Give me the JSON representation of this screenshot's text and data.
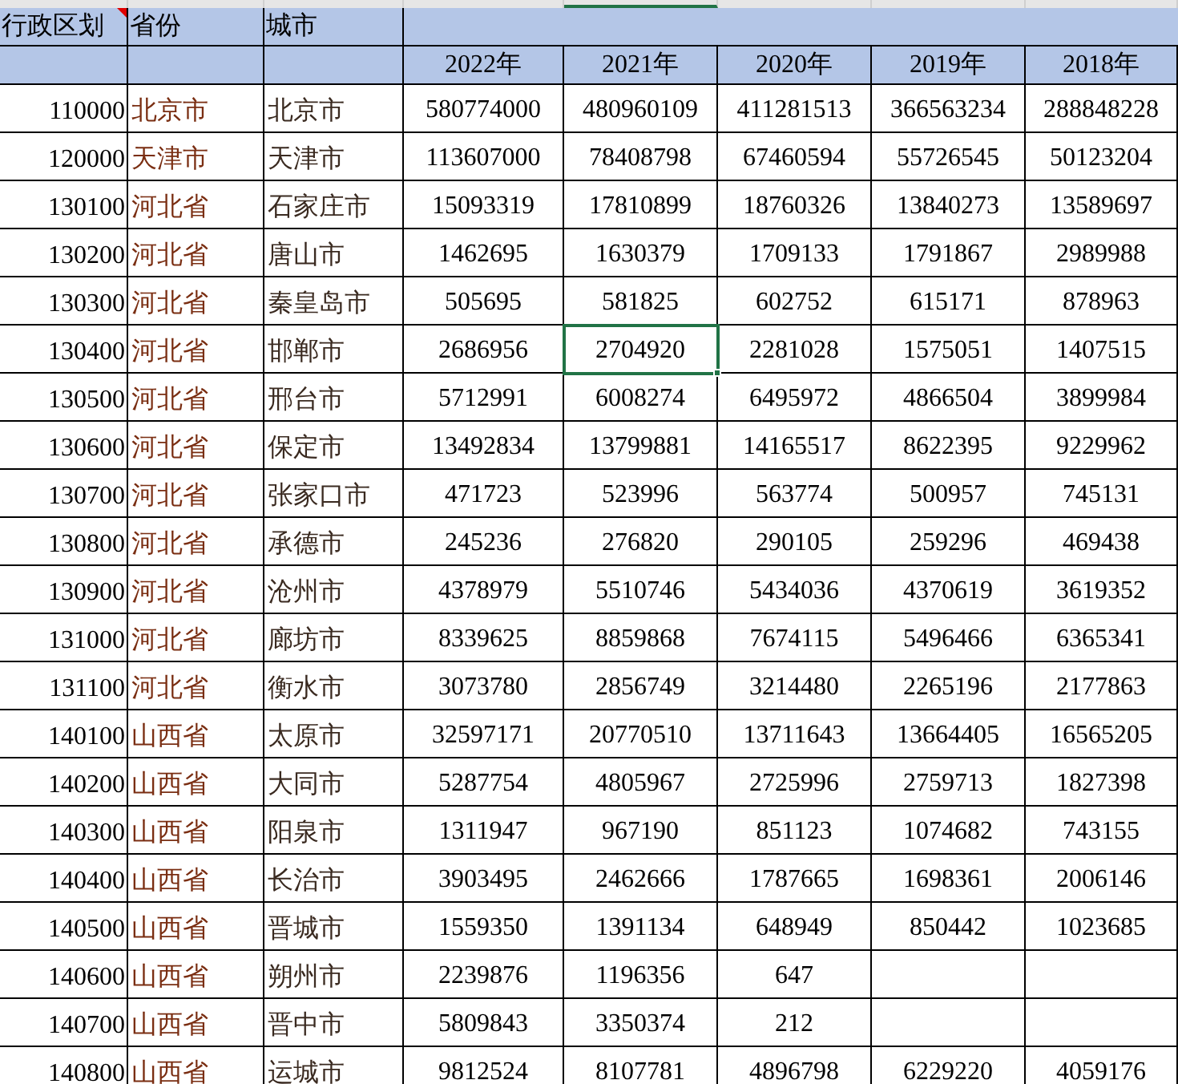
{
  "header": {
    "columns": [
      {
        "label": "行政区划",
        "comment": true
      },
      {
        "label": "省份",
        "comment": false
      },
      {
        "label": "城市",
        "comment": false
      }
    ],
    "years": [
      "2022年",
      "2021年",
      "2020年",
      "2019年",
      "2018年"
    ]
  },
  "rows": [
    {
      "code": "110000",
      "province": "北京市",
      "city": "北京市",
      "values": [
        {
          "text": "580774000",
          "selected": false
        },
        {
          "text": "480960109",
          "selected": false
        },
        {
          "text": "411281513",
          "selected": false
        },
        {
          "text": "366563234",
          "selected": false
        },
        {
          "text": "288848228",
          "selected": false
        }
      ]
    },
    {
      "code": "120000",
      "province": "天津市",
      "city": "天津市",
      "values": [
        {
          "text": "113607000",
          "selected": false
        },
        {
          "text": "78408798",
          "selected": false
        },
        {
          "text": "67460594",
          "selected": false
        },
        {
          "text": "55726545",
          "selected": false
        },
        {
          "text": "50123204",
          "selected": false
        }
      ]
    },
    {
      "code": "130100",
      "province": "河北省",
      "city": "石家庄市",
      "values": [
        {
          "text": "15093319",
          "selected": false
        },
        {
          "text": "17810899",
          "selected": false
        },
        {
          "text": "18760326",
          "selected": false
        },
        {
          "text": "13840273",
          "selected": false
        },
        {
          "text": "13589697",
          "selected": false
        }
      ]
    },
    {
      "code": "130200",
      "province": "河北省",
      "city": "唐山市",
      "values": [
        {
          "text": "1462695",
          "selected": false
        },
        {
          "text": "1630379",
          "selected": false
        },
        {
          "text": "1709133",
          "selected": false
        },
        {
          "text": "1791867",
          "selected": false
        },
        {
          "text": "2989988",
          "selected": false
        }
      ]
    },
    {
      "code": "130300",
      "province": "河北省",
      "city": "秦皇岛市",
      "values": [
        {
          "text": "505695",
          "selected": false
        },
        {
          "text": "581825",
          "selected": false
        },
        {
          "text": "602752",
          "selected": false
        },
        {
          "text": "615171",
          "selected": false
        },
        {
          "text": "878963",
          "selected": false
        }
      ]
    },
    {
      "code": "130400",
      "province": "河北省",
      "city": "邯郸市",
      "values": [
        {
          "text": "2686956",
          "selected": false
        },
        {
          "text": "2704920",
          "selected": true
        },
        {
          "text": "2281028",
          "selected": false
        },
        {
          "text": "1575051",
          "selected": false
        },
        {
          "text": "1407515",
          "selected": false
        }
      ]
    },
    {
      "code": "130500",
      "province": "河北省",
      "city": "邢台市",
      "values": [
        {
          "text": "5712991",
          "selected": false
        },
        {
          "text": "6008274",
          "selected": false
        },
        {
          "text": "6495972",
          "selected": false
        },
        {
          "text": "4866504",
          "selected": false
        },
        {
          "text": "3899984",
          "selected": false
        }
      ]
    },
    {
      "code": "130600",
      "province": "河北省",
      "city": "保定市",
      "values": [
        {
          "text": "13492834",
          "selected": false
        },
        {
          "text": "13799881",
          "selected": false
        },
        {
          "text": "14165517",
          "selected": false
        },
        {
          "text": "8622395",
          "selected": false
        },
        {
          "text": "9229962",
          "selected": false
        }
      ]
    },
    {
      "code": "130700",
      "province": "河北省",
      "city": "张家口市",
      "values": [
        {
          "text": "471723",
          "selected": false
        },
        {
          "text": "523996",
          "selected": false
        },
        {
          "text": "563774",
          "selected": false
        },
        {
          "text": "500957",
          "selected": false
        },
        {
          "text": "745131",
          "selected": false
        }
      ]
    },
    {
      "code": "130800",
      "province": "河北省",
      "city": "承德市",
      "values": [
        {
          "text": "245236",
          "selected": false
        },
        {
          "text": "276820",
          "selected": false
        },
        {
          "text": "290105",
          "selected": false
        },
        {
          "text": "259296",
          "selected": false
        },
        {
          "text": "469438",
          "selected": false
        }
      ]
    },
    {
      "code": "130900",
      "province": "河北省",
      "city": "沧州市",
      "values": [
        {
          "text": "4378979",
          "selected": false
        },
        {
          "text": "5510746",
          "selected": false
        },
        {
          "text": "5434036",
          "selected": false
        },
        {
          "text": "4370619",
          "selected": false
        },
        {
          "text": "3619352",
          "selected": false
        }
      ]
    },
    {
      "code": "131000",
      "province": "河北省",
      "city": "廊坊市",
      "values": [
        {
          "text": "8339625",
          "selected": false
        },
        {
          "text": "8859868",
          "selected": false
        },
        {
          "text": "7674115",
          "selected": false
        },
        {
          "text": "5496466",
          "selected": false
        },
        {
          "text": "6365341",
          "selected": false
        }
      ]
    },
    {
      "code": "131100",
      "province": "河北省",
      "city": "衡水市",
      "values": [
        {
          "text": "3073780",
          "selected": false
        },
        {
          "text": "2856749",
          "selected": false
        },
        {
          "text": "3214480",
          "selected": false
        },
        {
          "text": "2265196",
          "selected": false
        },
        {
          "text": "2177863",
          "selected": false
        }
      ]
    },
    {
      "code": "140100",
      "province": "山西省",
      "city": "太原市",
      "values": [
        {
          "text": "32597171",
          "selected": false
        },
        {
          "text": "20770510",
          "selected": false
        },
        {
          "text": "13711643",
          "selected": false
        },
        {
          "text": "13664405",
          "selected": false
        },
        {
          "text": "16565205",
          "selected": false
        }
      ]
    },
    {
      "code": "140200",
      "province": "山西省",
      "city": "大同市",
      "values": [
        {
          "text": "5287754",
          "selected": false
        },
        {
          "text": "4805967",
          "selected": false
        },
        {
          "text": "2725996",
          "selected": false
        },
        {
          "text": "2759713",
          "selected": false
        },
        {
          "text": "1827398",
          "selected": false
        }
      ]
    },
    {
      "code": "140300",
      "province": "山西省",
      "city": "阳泉市",
      "values": [
        {
          "text": "1311947",
          "selected": false
        },
        {
          "text": "967190",
          "selected": false
        },
        {
          "text": "851123",
          "selected": false
        },
        {
          "text": "1074682",
          "selected": false
        },
        {
          "text": "743155",
          "selected": false
        }
      ]
    },
    {
      "code": "140400",
      "province": "山西省",
      "city": "长治市",
      "values": [
        {
          "text": "3903495",
          "selected": false
        },
        {
          "text": "2462666",
          "selected": false
        },
        {
          "text": "1787665",
          "selected": false
        },
        {
          "text": "1698361",
          "selected": false
        },
        {
          "text": "2006146",
          "selected": false
        }
      ]
    },
    {
      "code": "140500",
      "province": "山西省",
      "city": "晋城市",
      "values": [
        {
          "text": "1559350",
          "selected": false
        },
        {
          "text": "1391134",
          "selected": false
        },
        {
          "text": "648949",
          "selected": false
        },
        {
          "text": "850442",
          "selected": false
        },
        {
          "text": "1023685",
          "selected": false
        }
      ]
    },
    {
      "code": "140600",
      "province": "山西省",
      "city": "朔州市",
      "values": [
        {
          "text": "2239876",
          "selected": false
        },
        {
          "text": "1196356",
          "selected": false
        },
        {
          "text": "647",
          "selected": false
        }
      ]
    },
    {
      "code": "140700",
      "province": "山西省",
      "city": "晋中市",
      "values": [
        {
          "text": "5809843",
          "selected": false
        },
        {
          "text": "3350374",
          "selected": false
        },
        {
          "text": "212",
          "selected": false
        }
      ]
    },
    {
      "code": "140800",
      "province": "山西省",
      "city": "运城市",
      "values": [
        {
          "text": "9812524",
          "selected": false
        },
        {
          "text": "8107781",
          "selected": false
        },
        {
          "text": "4896798",
          "selected": false
        },
        {
          "text": "6229220",
          "selected": false
        },
        {
          "text": "4059176",
          "selected": false
        }
      ]
    }
  ]
}
